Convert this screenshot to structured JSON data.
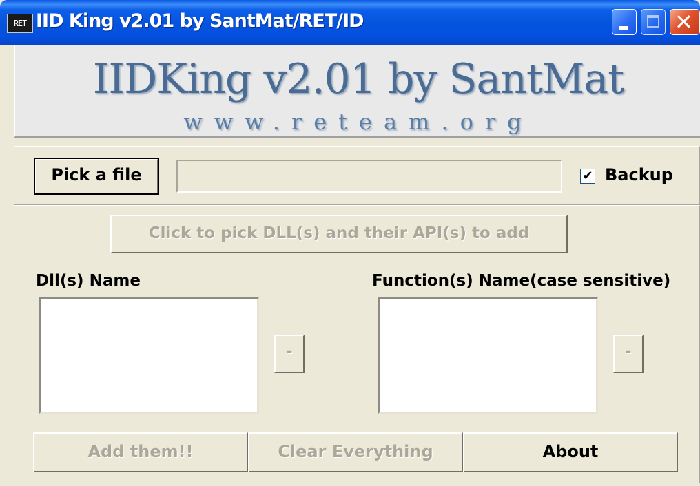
{
  "window": {
    "title": "IID King v2.01 by SantMat/RET/ID",
    "icon_text": "RET",
    "icon": "ret-app-icon",
    "controls": {
      "minimize": "minimize-icon",
      "maximize": "maximize-icon",
      "close_glyph": "✕"
    }
  },
  "banner": {
    "title": "IIDKing v2.01  by  SantMat",
    "url": "www.reteam.org"
  },
  "file_row": {
    "pick_button_label": "Pick a file",
    "file_path_value": "",
    "backup_checked": true,
    "backup_check_glyph": "✔",
    "backup_label": "Backup"
  },
  "main": {
    "pick_dll_button_label": "Click to pick DLL(s) and their API(s) to add",
    "dll_list_label": "Dll(s) Name",
    "function_list_label": "Function(s) Name(case sensitive)",
    "remove_dll_button_label": "-",
    "remove_function_button_label": "-"
  },
  "footer": {
    "add_button_label": "Add them!!",
    "clear_button_label": "Clear Everything",
    "about_button_label": "About"
  },
  "colors": {
    "window_bg": "#ece9d8",
    "titlebar_blue": "#0453dd",
    "close_red": "#e1532e",
    "banner_text": "#4a6c94",
    "disabled_text": "#aca899"
  }
}
